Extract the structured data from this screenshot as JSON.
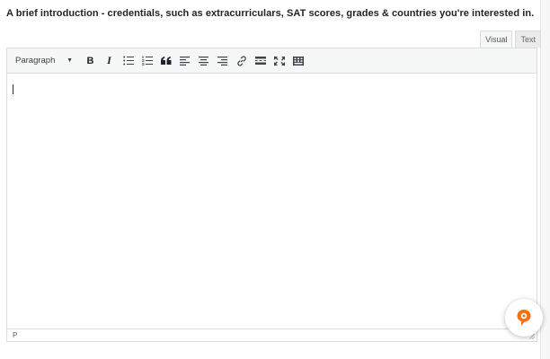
{
  "prompt": {
    "text": "A brief introduction - credentials, such as extracurriculars, SAT scores, grades & countries you're interested in."
  },
  "editor": {
    "tabs": [
      {
        "label": "Visual",
        "active": true
      },
      {
        "label": "Text",
        "active": false
      }
    ],
    "format_select": {
      "selected": "Paragraph"
    },
    "toolbar_icons": [
      "bold-icon",
      "italic-icon",
      "bulleted-list-icon",
      "numbered-list-icon",
      "blockquote-icon",
      "align-left-icon",
      "align-center-icon",
      "align-right-icon",
      "insert-link-icon",
      "read-more-icon",
      "fullscreen-icon",
      "toolbar-toggle-icon"
    ],
    "bold_label": "B",
    "italic_label": "I",
    "status_path": "P"
  },
  "colors": {
    "toolbar_bg": "#f6f7f7",
    "border": "#dcdcde",
    "fab_accent": "#f2730f"
  },
  "help_fab": {
    "icon": "chat-assistant-icon"
  }
}
